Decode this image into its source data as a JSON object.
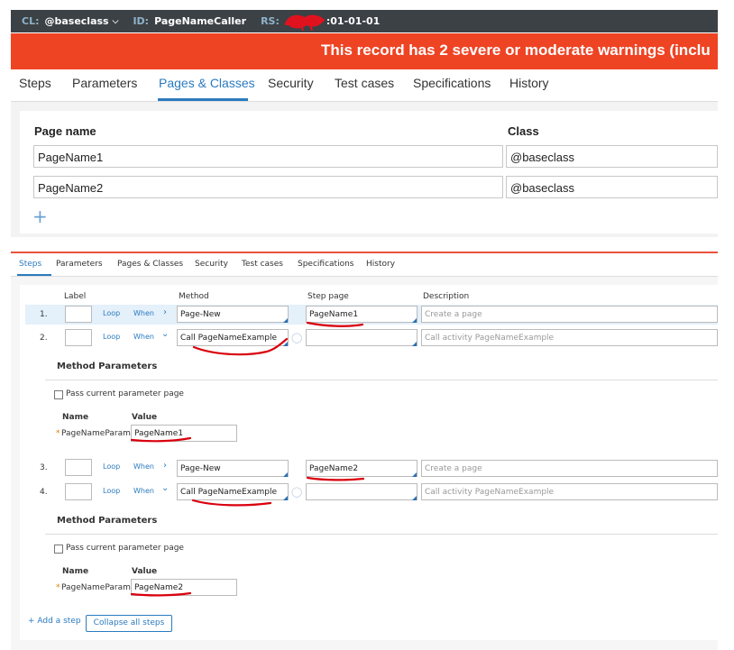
{
  "header": {
    "cl_label": "CL:",
    "cl_value": "@baseclass",
    "id_label": "ID:",
    "id_value": "PageNameCaller",
    "rs_label": "RS:",
    "rs_value": ":01-01-01"
  },
  "warning_banner": "This record has 2 severe or moderate warnings (inclu",
  "tabs_top": [
    "Steps",
    "Parameters",
    "Pages & Classes",
    "Security",
    "Test cases",
    "Specifications",
    "History"
  ],
  "active_tab_top": "Pages & Classes",
  "pages_classes": {
    "col_page": "Page name",
    "col_class": "Class",
    "rows": [
      {
        "page": "PageName1",
        "class": "@baseclass"
      },
      {
        "page": "PageName2",
        "class": "@baseclass"
      }
    ],
    "add_icon": "plus-icon"
  },
  "tabs_bottom": [
    "Steps",
    "Parameters",
    "Pages & Classes",
    "Security",
    "Test cases",
    "Specifications",
    "History"
  ],
  "active_tab_bottom": "Steps",
  "steps_columns": {
    "label": "Label",
    "method": "Method",
    "step_page": "Step page",
    "description": "Description"
  },
  "loop_label": "Loop",
  "when_label": "When",
  "steps": [
    {
      "num": "1.",
      "method": "Page-New",
      "step_page": "PageName1",
      "description": "Create a page"
    },
    {
      "num": "2.",
      "method": "Call PageNameExample",
      "step_page": "",
      "description": "Call activity PageNameExample"
    },
    {
      "num": "3.",
      "method": "Page-New",
      "step_page": "PageName2",
      "description": "Create a page"
    },
    {
      "num": "4.",
      "method": "Call PageNameExample",
      "step_page": "",
      "description": "Call activity PageNameExample"
    }
  ],
  "method_params": [
    {
      "title": "Method Parameters",
      "pass_label": "Pass current parameter page",
      "col_name": "Name",
      "col_value": "Value",
      "param_name": "PageNameParam",
      "param_value": "PageName1"
    },
    {
      "title": "Method Parameters",
      "pass_label": "Pass current parameter page",
      "col_name": "Name",
      "col_value": "Value",
      "param_name": "PageNameParam",
      "param_value": "PageName2"
    }
  ],
  "required_star": "*",
  "add_step_label": "+ Add a step",
  "collapse_label": "Collapse all steps",
  "colors": {
    "accent": "#2b7bbf",
    "warning": "#ee4424",
    "header_bg": "#3c4146",
    "annotation": "#d9000d"
  }
}
